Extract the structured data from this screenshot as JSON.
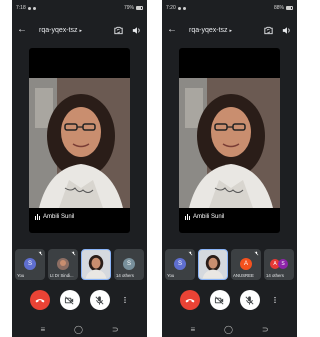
{
  "screens": [
    {
      "status": {
        "time": "7:18",
        "right": "79%"
      },
      "meeting_code": "rqa-yqex-tsz",
      "main_video": {
        "speaker_name": "Ambili Sunil"
      },
      "participants": [
        {
          "label": "You",
          "initial": "S",
          "color": "#5f6fd1"
        },
        {
          "label": "Lt Dr Sindi...",
          "initial": "",
          "color": "#8d6e63"
        },
        {
          "label": "",
          "initial": "",
          "color": "#cfd8dc"
        },
        {
          "label": "14 others",
          "initial": "S",
          "color": "#78909c"
        }
      ]
    },
    {
      "status": {
        "time": "7:20",
        "right": "88%"
      },
      "meeting_code": "rqa-yqex-tsz",
      "main_video": {
        "speaker_name": "Ambili Sunil"
      },
      "participants": [
        {
          "label": "You",
          "initial": "S",
          "color": "#5f6fd1"
        },
        {
          "label": "",
          "initial": "",
          "color": "#cfd8dc"
        },
        {
          "label": "ANUSREE",
          "initial": "A",
          "color": "#f4511e"
        },
        {
          "label": "14 others",
          "initial": "A",
          "color": "#e53935",
          "initial2": "S",
          "color2": "#8e24aa"
        }
      ]
    }
  ],
  "nav": {
    "recents": "≡",
    "home": "◯",
    "back": "⊃"
  }
}
